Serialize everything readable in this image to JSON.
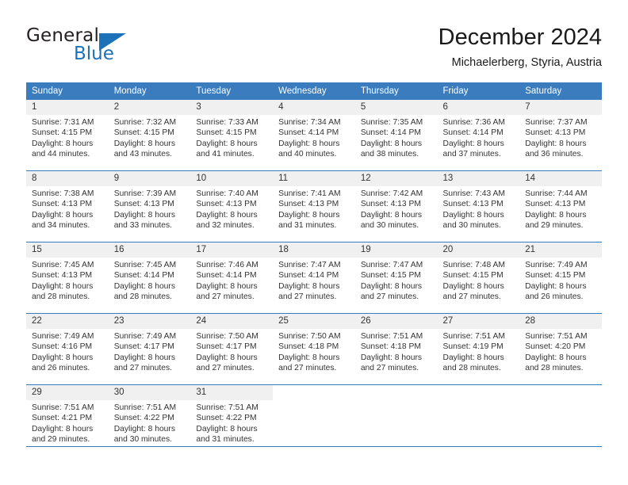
{
  "brand": {
    "name_part1": "General",
    "name_part2": "Blue",
    "logo_icon": "triangle-flag-icon",
    "accent_color": "#1d71b8"
  },
  "header": {
    "month_title": "December 2024",
    "location": "Michaelerberg, Styria, Austria"
  },
  "calendar": {
    "header_bg_color": "#3a7cbe",
    "daynum_bg_color": "#f0f0f0",
    "weekday_headers": [
      "Sunday",
      "Monday",
      "Tuesday",
      "Wednesday",
      "Thursday",
      "Friday",
      "Saturday"
    ],
    "weeks": [
      [
        {
          "day": "1",
          "sunrise": "Sunrise: 7:31 AM",
          "sunset": "Sunset: 4:15 PM",
          "daylight_line1": "Daylight: 8 hours",
          "daylight_line2": "and 44 minutes."
        },
        {
          "day": "2",
          "sunrise": "Sunrise: 7:32 AM",
          "sunset": "Sunset: 4:15 PM",
          "daylight_line1": "Daylight: 8 hours",
          "daylight_line2": "and 43 minutes."
        },
        {
          "day": "3",
          "sunrise": "Sunrise: 7:33 AM",
          "sunset": "Sunset: 4:15 PM",
          "daylight_line1": "Daylight: 8 hours",
          "daylight_line2": "and 41 minutes."
        },
        {
          "day": "4",
          "sunrise": "Sunrise: 7:34 AM",
          "sunset": "Sunset: 4:14 PM",
          "daylight_line1": "Daylight: 8 hours",
          "daylight_line2": "and 40 minutes."
        },
        {
          "day": "5",
          "sunrise": "Sunrise: 7:35 AM",
          "sunset": "Sunset: 4:14 PM",
          "daylight_line1": "Daylight: 8 hours",
          "daylight_line2": "and 38 minutes."
        },
        {
          "day": "6",
          "sunrise": "Sunrise: 7:36 AM",
          "sunset": "Sunset: 4:14 PM",
          "daylight_line1": "Daylight: 8 hours",
          "daylight_line2": "and 37 minutes."
        },
        {
          "day": "7",
          "sunrise": "Sunrise: 7:37 AM",
          "sunset": "Sunset: 4:13 PM",
          "daylight_line1": "Daylight: 8 hours",
          "daylight_line2": "and 36 minutes."
        }
      ],
      [
        {
          "day": "8",
          "sunrise": "Sunrise: 7:38 AM",
          "sunset": "Sunset: 4:13 PM",
          "daylight_line1": "Daylight: 8 hours",
          "daylight_line2": "and 34 minutes."
        },
        {
          "day": "9",
          "sunrise": "Sunrise: 7:39 AM",
          "sunset": "Sunset: 4:13 PM",
          "daylight_line1": "Daylight: 8 hours",
          "daylight_line2": "and 33 minutes."
        },
        {
          "day": "10",
          "sunrise": "Sunrise: 7:40 AM",
          "sunset": "Sunset: 4:13 PM",
          "daylight_line1": "Daylight: 8 hours",
          "daylight_line2": "and 32 minutes."
        },
        {
          "day": "11",
          "sunrise": "Sunrise: 7:41 AM",
          "sunset": "Sunset: 4:13 PM",
          "daylight_line1": "Daylight: 8 hours",
          "daylight_line2": "and 31 minutes."
        },
        {
          "day": "12",
          "sunrise": "Sunrise: 7:42 AM",
          "sunset": "Sunset: 4:13 PM",
          "daylight_line1": "Daylight: 8 hours",
          "daylight_line2": "and 30 minutes."
        },
        {
          "day": "13",
          "sunrise": "Sunrise: 7:43 AM",
          "sunset": "Sunset: 4:13 PM",
          "daylight_line1": "Daylight: 8 hours",
          "daylight_line2": "and 30 minutes."
        },
        {
          "day": "14",
          "sunrise": "Sunrise: 7:44 AM",
          "sunset": "Sunset: 4:13 PM",
          "daylight_line1": "Daylight: 8 hours",
          "daylight_line2": "and 29 minutes."
        }
      ],
      [
        {
          "day": "15",
          "sunrise": "Sunrise: 7:45 AM",
          "sunset": "Sunset: 4:13 PM",
          "daylight_line1": "Daylight: 8 hours",
          "daylight_line2": "and 28 minutes."
        },
        {
          "day": "16",
          "sunrise": "Sunrise: 7:45 AM",
          "sunset": "Sunset: 4:14 PM",
          "daylight_line1": "Daylight: 8 hours",
          "daylight_line2": "and 28 minutes."
        },
        {
          "day": "17",
          "sunrise": "Sunrise: 7:46 AM",
          "sunset": "Sunset: 4:14 PM",
          "daylight_line1": "Daylight: 8 hours",
          "daylight_line2": "and 27 minutes."
        },
        {
          "day": "18",
          "sunrise": "Sunrise: 7:47 AM",
          "sunset": "Sunset: 4:14 PM",
          "daylight_line1": "Daylight: 8 hours",
          "daylight_line2": "and 27 minutes."
        },
        {
          "day": "19",
          "sunrise": "Sunrise: 7:47 AM",
          "sunset": "Sunset: 4:15 PM",
          "daylight_line1": "Daylight: 8 hours",
          "daylight_line2": "and 27 minutes."
        },
        {
          "day": "20",
          "sunrise": "Sunrise: 7:48 AM",
          "sunset": "Sunset: 4:15 PM",
          "daylight_line1": "Daylight: 8 hours",
          "daylight_line2": "and 27 minutes."
        },
        {
          "day": "21",
          "sunrise": "Sunrise: 7:49 AM",
          "sunset": "Sunset: 4:15 PM",
          "daylight_line1": "Daylight: 8 hours",
          "daylight_line2": "and 26 minutes."
        }
      ],
      [
        {
          "day": "22",
          "sunrise": "Sunrise: 7:49 AM",
          "sunset": "Sunset: 4:16 PM",
          "daylight_line1": "Daylight: 8 hours",
          "daylight_line2": "and 26 minutes."
        },
        {
          "day": "23",
          "sunrise": "Sunrise: 7:49 AM",
          "sunset": "Sunset: 4:17 PM",
          "daylight_line1": "Daylight: 8 hours",
          "daylight_line2": "and 27 minutes."
        },
        {
          "day": "24",
          "sunrise": "Sunrise: 7:50 AM",
          "sunset": "Sunset: 4:17 PM",
          "daylight_line1": "Daylight: 8 hours",
          "daylight_line2": "and 27 minutes."
        },
        {
          "day": "25",
          "sunrise": "Sunrise: 7:50 AM",
          "sunset": "Sunset: 4:18 PM",
          "daylight_line1": "Daylight: 8 hours",
          "daylight_line2": "and 27 minutes."
        },
        {
          "day": "26",
          "sunrise": "Sunrise: 7:51 AM",
          "sunset": "Sunset: 4:18 PM",
          "daylight_line1": "Daylight: 8 hours",
          "daylight_line2": "and 27 minutes."
        },
        {
          "day": "27",
          "sunrise": "Sunrise: 7:51 AM",
          "sunset": "Sunset: 4:19 PM",
          "daylight_line1": "Daylight: 8 hours",
          "daylight_line2": "and 28 minutes."
        },
        {
          "day": "28",
          "sunrise": "Sunrise: 7:51 AM",
          "sunset": "Sunset: 4:20 PM",
          "daylight_line1": "Daylight: 8 hours",
          "daylight_line2": "and 28 minutes."
        }
      ],
      [
        {
          "day": "29",
          "sunrise": "Sunrise: 7:51 AM",
          "sunset": "Sunset: 4:21 PM",
          "daylight_line1": "Daylight: 8 hours",
          "daylight_line2": "and 29 minutes."
        },
        {
          "day": "30",
          "sunrise": "Sunrise: 7:51 AM",
          "sunset": "Sunset: 4:22 PM",
          "daylight_line1": "Daylight: 8 hours",
          "daylight_line2": "and 30 minutes."
        },
        {
          "day": "31",
          "sunrise": "Sunrise: 7:51 AM",
          "sunset": "Sunset: 4:22 PM",
          "daylight_line1": "Daylight: 8 hours",
          "daylight_line2": "and 31 minutes."
        },
        {
          "day": "",
          "sunrise": "",
          "sunset": "",
          "daylight_line1": "",
          "daylight_line2": ""
        },
        {
          "day": "",
          "sunrise": "",
          "sunset": "",
          "daylight_line1": "",
          "daylight_line2": ""
        },
        {
          "day": "",
          "sunrise": "",
          "sunset": "",
          "daylight_line1": "",
          "daylight_line2": ""
        },
        {
          "day": "",
          "sunrise": "",
          "sunset": "",
          "daylight_line1": "",
          "daylight_line2": ""
        }
      ]
    ]
  }
}
